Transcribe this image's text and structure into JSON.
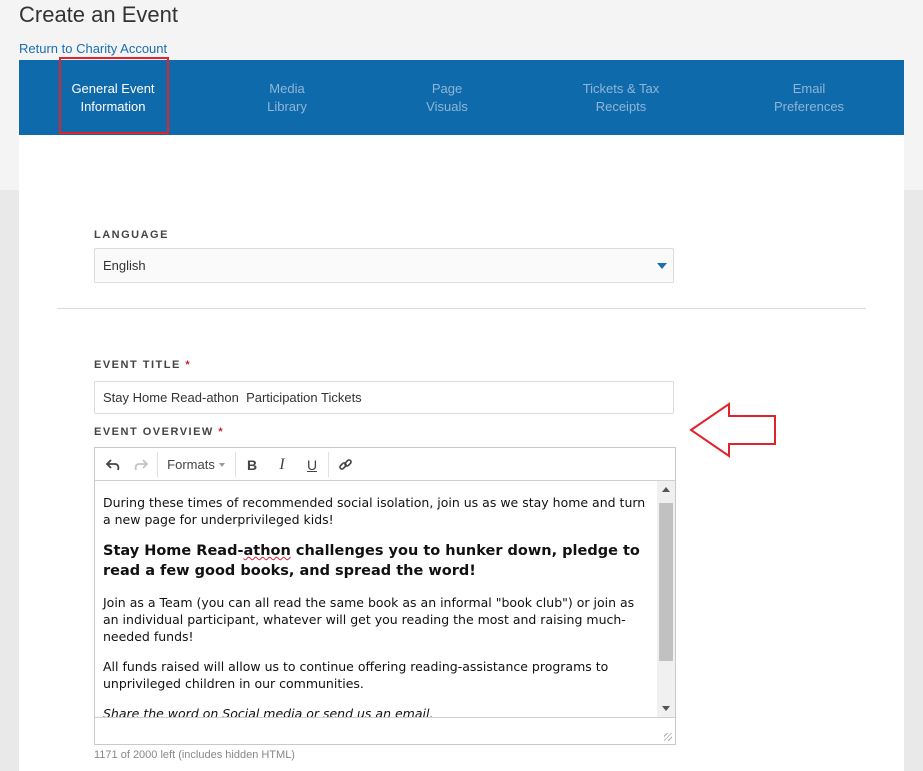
{
  "page": {
    "title": "Create an Event",
    "back_link": "Return to Charity Account"
  },
  "tabs": [
    {
      "line1": "General Event",
      "line2": "Information",
      "active": true
    },
    {
      "line1": "Media",
      "line2": "Library",
      "active": false
    },
    {
      "line1": "Page",
      "line2": "Visuals",
      "active": false
    },
    {
      "line1": "Tickets & Tax",
      "line2": "Receipts",
      "active": false
    },
    {
      "line1": "Email",
      "line2": "Preferences",
      "active": false
    }
  ],
  "form": {
    "language_label": "LANGUAGE",
    "language_value": "English",
    "event_title_label": "EVENT TITLE",
    "required_mark": "*",
    "event_title_value": "Stay Home Read-athon  Participation Tickets",
    "event_overview_label": "EVENT OVERVIEW"
  },
  "editor": {
    "toolbar": {
      "formats_label": "Formats",
      "bold_label": "B",
      "italic_label": "I",
      "underline_label": "U"
    },
    "content": {
      "p1": "During these times of recommended social isolation, join us as we stay home and turn a new page for underprivileged kids!",
      "heading_before": "Stay Home Read-",
      "heading_spell": "athon",
      "heading_after": " challenges you to hunker down, pledge to read a few good books, and spread the word!",
      "p2": "Join as a Team (you can all read the same book as an informal \"book club\") or join as an individual participant, whatever will get you reading the most and raising much-needed funds!",
      "p3": "All funds raised will allow us to continue offering reading-assistance programs to unprivileged children in our communities.",
      "p4": "Share the word on Social media or send us an email."
    },
    "char_counter": "1171 of 2000 left (includes hidden HTML)"
  },
  "colors": {
    "tab_bar": "#0f6aab",
    "highlight": "#e0242c",
    "link": "#1a6fb0"
  }
}
